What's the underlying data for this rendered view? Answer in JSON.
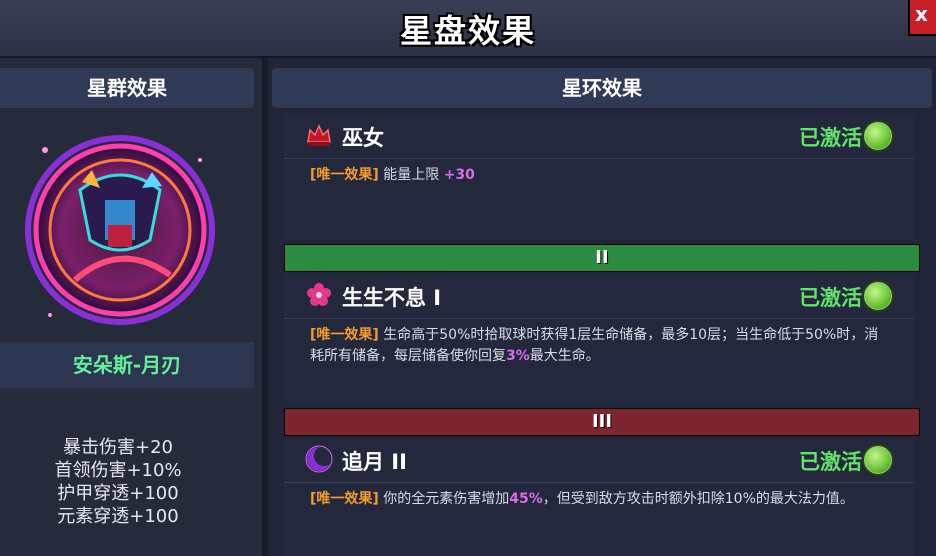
{
  "window": {
    "title": "星盘效果",
    "close_label": "x"
  },
  "left_panel": {
    "header": "星群效果",
    "constellation_name": "安朵斯-月刃",
    "stats": [
      "暴击伤害+20",
      "首领伤害+10%",
      "护甲穿透+100",
      "元素穿透+100"
    ]
  },
  "right_panel": {
    "header": "星环效果",
    "tiers": [
      {
        "band": "",
        "name": "巫女",
        "status": "已激活",
        "tag": "[唯一效果]",
        "desc_parts": [
          "能量上限 ",
          "+30",
          ""
        ],
        "icon": "crown-icon"
      },
      {
        "band": "II",
        "name": "生生不息 I",
        "status": "已激活",
        "tag": "[唯一效果]",
        "desc_parts": [
          "生命高于50%时拾取球时获得1层生命储备，最多10层；当生命低于50%时，消耗所有储备，每层储备使你回复",
          "3%",
          "最大生命。"
        ],
        "icon": "flower-icon"
      },
      {
        "band": "III",
        "name": "追月 II",
        "status": "已激活",
        "tag": "[唯一效果]",
        "desc_parts": [
          "你的全元素伤害增加",
          "45%",
          "，但受到敌方攻击时额外扣除10%的最大法力值。"
        ],
        "icon": "crescent-moon-icon"
      }
    ]
  },
  "colors": {
    "active": "#62e26a",
    "accent": "#d86ce8",
    "tag": "#f39c2b",
    "band_green": "#2a8c3e",
    "band_red": "#7e2630"
  }
}
